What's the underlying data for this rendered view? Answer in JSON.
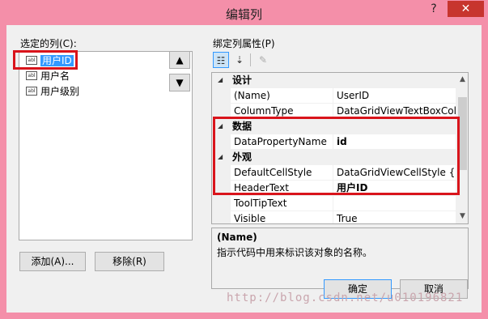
{
  "window": {
    "title": "编辑列",
    "help_label": "?",
    "close_label": "✕"
  },
  "left": {
    "selected_columns_label": "选定的列(C):",
    "columns": [
      {
        "label": "用户ID",
        "selected": true
      },
      {
        "label": "用户名",
        "selected": false
      },
      {
        "label": "用户级别",
        "selected": false
      }
    ],
    "move_up_label": "▲",
    "move_down_label": "▼",
    "add_button_label": "添加(A)...",
    "remove_button_label": "移除(R)"
  },
  "right": {
    "bound_props_label": "绑定列属性(P)",
    "toolbar": {
      "categorized_icon": "categorized-icon",
      "alphabetical_icon": "alphabetical-icon",
      "property_pages_icon": "wrench-icon"
    },
    "categories": [
      {
        "name": "设计",
        "properties": [
          {
            "name": "(Name)",
            "value": "UserID",
            "bold": false
          },
          {
            "name": "ColumnType",
            "value": "DataGridViewTextBoxColu",
            "bold": false
          }
        ]
      },
      {
        "name": "数据",
        "properties": [
          {
            "name": "DataPropertyName",
            "value": "id",
            "bold": true
          }
        ]
      },
      {
        "name": "外观",
        "properties": [
          {
            "name": "DefaultCellStyle",
            "value": "DataGridViewCellStyle { }",
            "bold": false
          },
          {
            "name": "HeaderText",
            "value": "用户ID",
            "bold": true
          },
          {
            "name": "ToolTipText",
            "value": "",
            "bold": false
          },
          {
            "name": "Visible",
            "value": "True",
            "bold": false
          }
        ]
      }
    ],
    "description": {
      "title": "(Name)",
      "text": "指示代码中用来标识该对象的名称。"
    }
  },
  "footer": {
    "ok_label": "确定",
    "cancel_label": "取消"
  },
  "watermark": "http://blog.csdn.net/u010196821",
  "colors": {
    "titlebar": "#f48fa9",
    "close_button": "#c7352e",
    "highlight_box": "#d9141b",
    "selection": "#3399ff"
  }
}
